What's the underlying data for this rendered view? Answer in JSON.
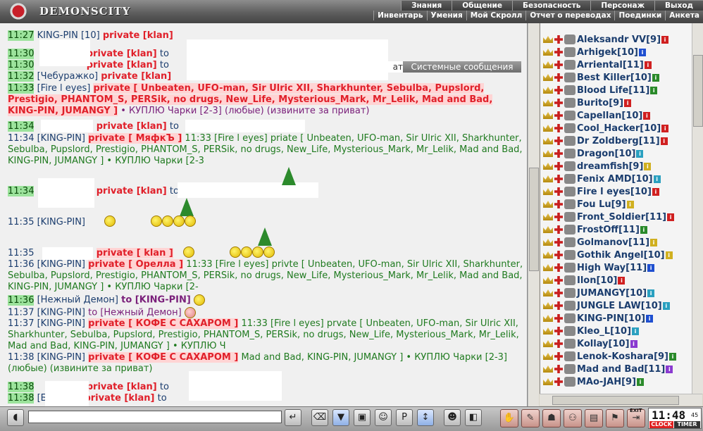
{
  "app": {
    "logo_text": "DEMONSCITY"
  },
  "menu_top": [
    "Знания",
    "Общение",
    "Безопасность",
    "Персонаж",
    "Выход"
  ],
  "menu_bottom": [
    "Инвентарь",
    "Умения",
    "Мой Скролл",
    "Отчет о переводах",
    "Поединки",
    "Анкета"
  ],
  "chat_tabs": {
    "partial": "ат",
    "system": "Системные сообщения"
  },
  "chat": {
    "l1": {
      "time": "11:27",
      "nick": "KING-PIN [10]",
      "priv": "private [klan]"
    },
    "l2": {
      "time": "11:30",
      "priv": "private [klan]",
      "to": "to"
    },
    "l3": {
      "time": "11:30",
      "priv": "private [klan]",
      "to": "to"
    },
    "l4": {
      "time": "11:32",
      "nick": "[Чебуражко]",
      "priv": "private [klan]"
    },
    "l5": {
      "time": "11:33",
      "nick": "[Fire l eyes]",
      "priv": "private [ Unbeaten, UFO-man, Sir Ulric XII, Sharkhunter, Sebulba, Pupslord, Prestigio, PHANTOM_S, PERSik, no drugs, New_Life, Mysterious_Mark, Mr_Lelik, Mad and Bad, KING-PIN, JUMANGY ]",
      "msg": "• КУПЛЮ Чарки [2-3] (любые) (извините за приват)"
    },
    "l6": {
      "time": "11:34",
      "priv": "private [klan]",
      "to": "to"
    },
    "l7": {
      "time": "11:34",
      "nick": "[KING-PIN]",
      "priv": "private [ МяфкЪ ]",
      "msg": "11:33 [Fire l eyes] priate [ Unbeaten, UFO-man, Sir Ulric XII, Sharkhunter, Sebulba, Pupslord, Prestigio, PHANTOM_S, PERSik, no drugs, New_Life, Mysterious_Mark, Mr_Lelik, Mad and Bad, KING-PIN, JUMANGY ] • КУПЛЮ Чарки [2-3"
    },
    "l8": {
      "time": "11:34",
      "priv": "private [klan]",
      "to": "to"
    },
    "l9": {
      "time": "11:35",
      "nick": "[KING-PIN]"
    },
    "l10": {
      "time": "11:35",
      "priv": "private [ klan ]"
    },
    "l11": {
      "time": "11:36",
      "nick": "[KING-PIN]",
      "priv": "private [ Орелла ]",
      "msg": "11:33 [Fire l eyes] privte [ Unbeaten, UFO-man, Sir Ulric XII, Sharkhunter, Sebulba, Pupslord, Prestigio, PHANTOM_S, PERSik, no drugs, New_Life, Mysterious_Mark, Mr_Lelik, Mad and Bad, KING-PIN, JUMANGY ] • КУПЛЮ Чарки [2-"
    },
    "l12": {
      "time": "11:36",
      "nick": "[Нежный Демон]",
      "to": "to [KING-PIN]"
    },
    "l13": {
      "time": "11:37",
      "nick": "[KING-PIN]",
      "to": "to [Нежный Демон]"
    },
    "l14": {
      "time": "11:37",
      "nick": "[KING-PIN]",
      "priv": "private [ КОФЕ С САХАРОМ ]",
      "msg": "11:33 [Fire l eyes] prvate [ Unbeaten, UFO-man, Sir Ulric XII, Sharkhunter, Sebulba, Pupslord, Prestigio, PHANTOM_S, PERSik, no drugs, New_Life, Mysterious_Mark, Mr_Lelik, Mad and Bad, KING-PIN, JUMANGY ] • КУПЛЮ Ч"
    },
    "l15": {
      "time": "11:38",
      "nick": "[KING-PIN]",
      "priv": "private [ КОФЕ С САХАРОМ ]",
      "msg": "Mad and Bad, KING-PIN, JUMANGY ] • КУПЛЮ Чарки [2-3] (любые) (извините за приват)"
    },
    "l16": {
      "time": "11:38",
      "priv": "private [klan]",
      "to": "to"
    },
    "l17": {
      "time": "11:38",
      "nick": "[Блафер]",
      "priv": "private [klan]",
      "to": "to"
    }
  },
  "users": [
    {
      "name": "Aleksandr VV",
      "level": "[9]",
      "badge": "#d02020"
    },
    {
      "name": "Arhigek",
      "level": "[10]",
      "badge": "#1f4fd0"
    },
    {
      "name": "Arriental",
      "level": "[11]",
      "badge": "#d02020"
    },
    {
      "name": "Best Killer",
      "level": "[10]",
      "badge": "#2a8a2a"
    },
    {
      "name": "Blood Life",
      "level": "[11]",
      "badge": "#2a8a2a"
    },
    {
      "name": "Burito",
      "level": "[9]",
      "badge": "#d02020"
    },
    {
      "name": "Capellan",
      "level": "[10]",
      "badge": "#d02020"
    },
    {
      "name": "Cool_Hacker",
      "level": "[10]",
      "badge": "#d02020"
    },
    {
      "name": "Dr Zoldberg",
      "level": "[11]",
      "badge": "#d02020"
    },
    {
      "name": "Dragon",
      "level": "[10]",
      "badge": "#2aa0c0"
    },
    {
      "name": "dreamfish",
      "level": "[9]",
      "badge": "#d0b020"
    },
    {
      "name": "Fenix AMD",
      "level": "[10]",
      "badge": "#2aa0c0"
    },
    {
      "name": "Fire l eyes",
      "level": "[10]",
      "badge": "#d02020"
    },
    {
      "name": "Fou Lu",
      "level": "[9]",
      "badge": "#d0b020"
    },
    {
      "name": "Front_Soldier",
      "level": "[11]",
      "badge": "#d02020"
    },
    {
      "name": "FrostOff",
      "level": "[11]",
      "badge": "#2a8a2a"
    },
    {
      "name": "Golmanov",
      "level": "[11]",
      "badge": "#d0b020"
    },
    {
      "name": "Gothik Angel",
      "level": "[10]",
      "badge": "#d0b020"
    },
    {
      "name": "High Way",
      "level": "[11]",
      "badge": "#1f4fd0"
    },
    {
      "name": "Ilon",
      "level": "[10]",
      "badge": "#d02020"
    },
    {
      "name": "JUMANGY",
      "level": "[10]",
      "badge": "#2aa0c0"
    },
    {
      "name": "JUNGLE LAW",
      "level": "[10]",
      "badge": "#2aa0c0"
    },
    {
      "name": "KING-PIN",
      "level": "[10]",
      "badge": "#1f4fd0"
    },
    {
      "name": "Kleo_L",
      "level": "[10]",
      "badge": "#2aa0c0"
    },
    {
      "name": "Kollay",
      "level": "[10]",
      "badge": "#8a3ad0"
    },
    {
      "name": "Lenok-Koshara",
      "level": "[9]",
      "badge": "#2a8a2a"
    },
    {
      "name": "Mad and Bad",
      "level": "[11]",
      "badge": "#8a3ad0"
    },
    {
      "name": "MAo-JAH",
      "level": "[9]",
      "badge": "#2a8a2a"
    }
  ],
  "clock": {
    "time": "11:48",
    "sec": "45",
    "clock_label": "CLOCK",
    "timer_label": "TIMER"
  },
  "exit_label": "EXIT"
}
